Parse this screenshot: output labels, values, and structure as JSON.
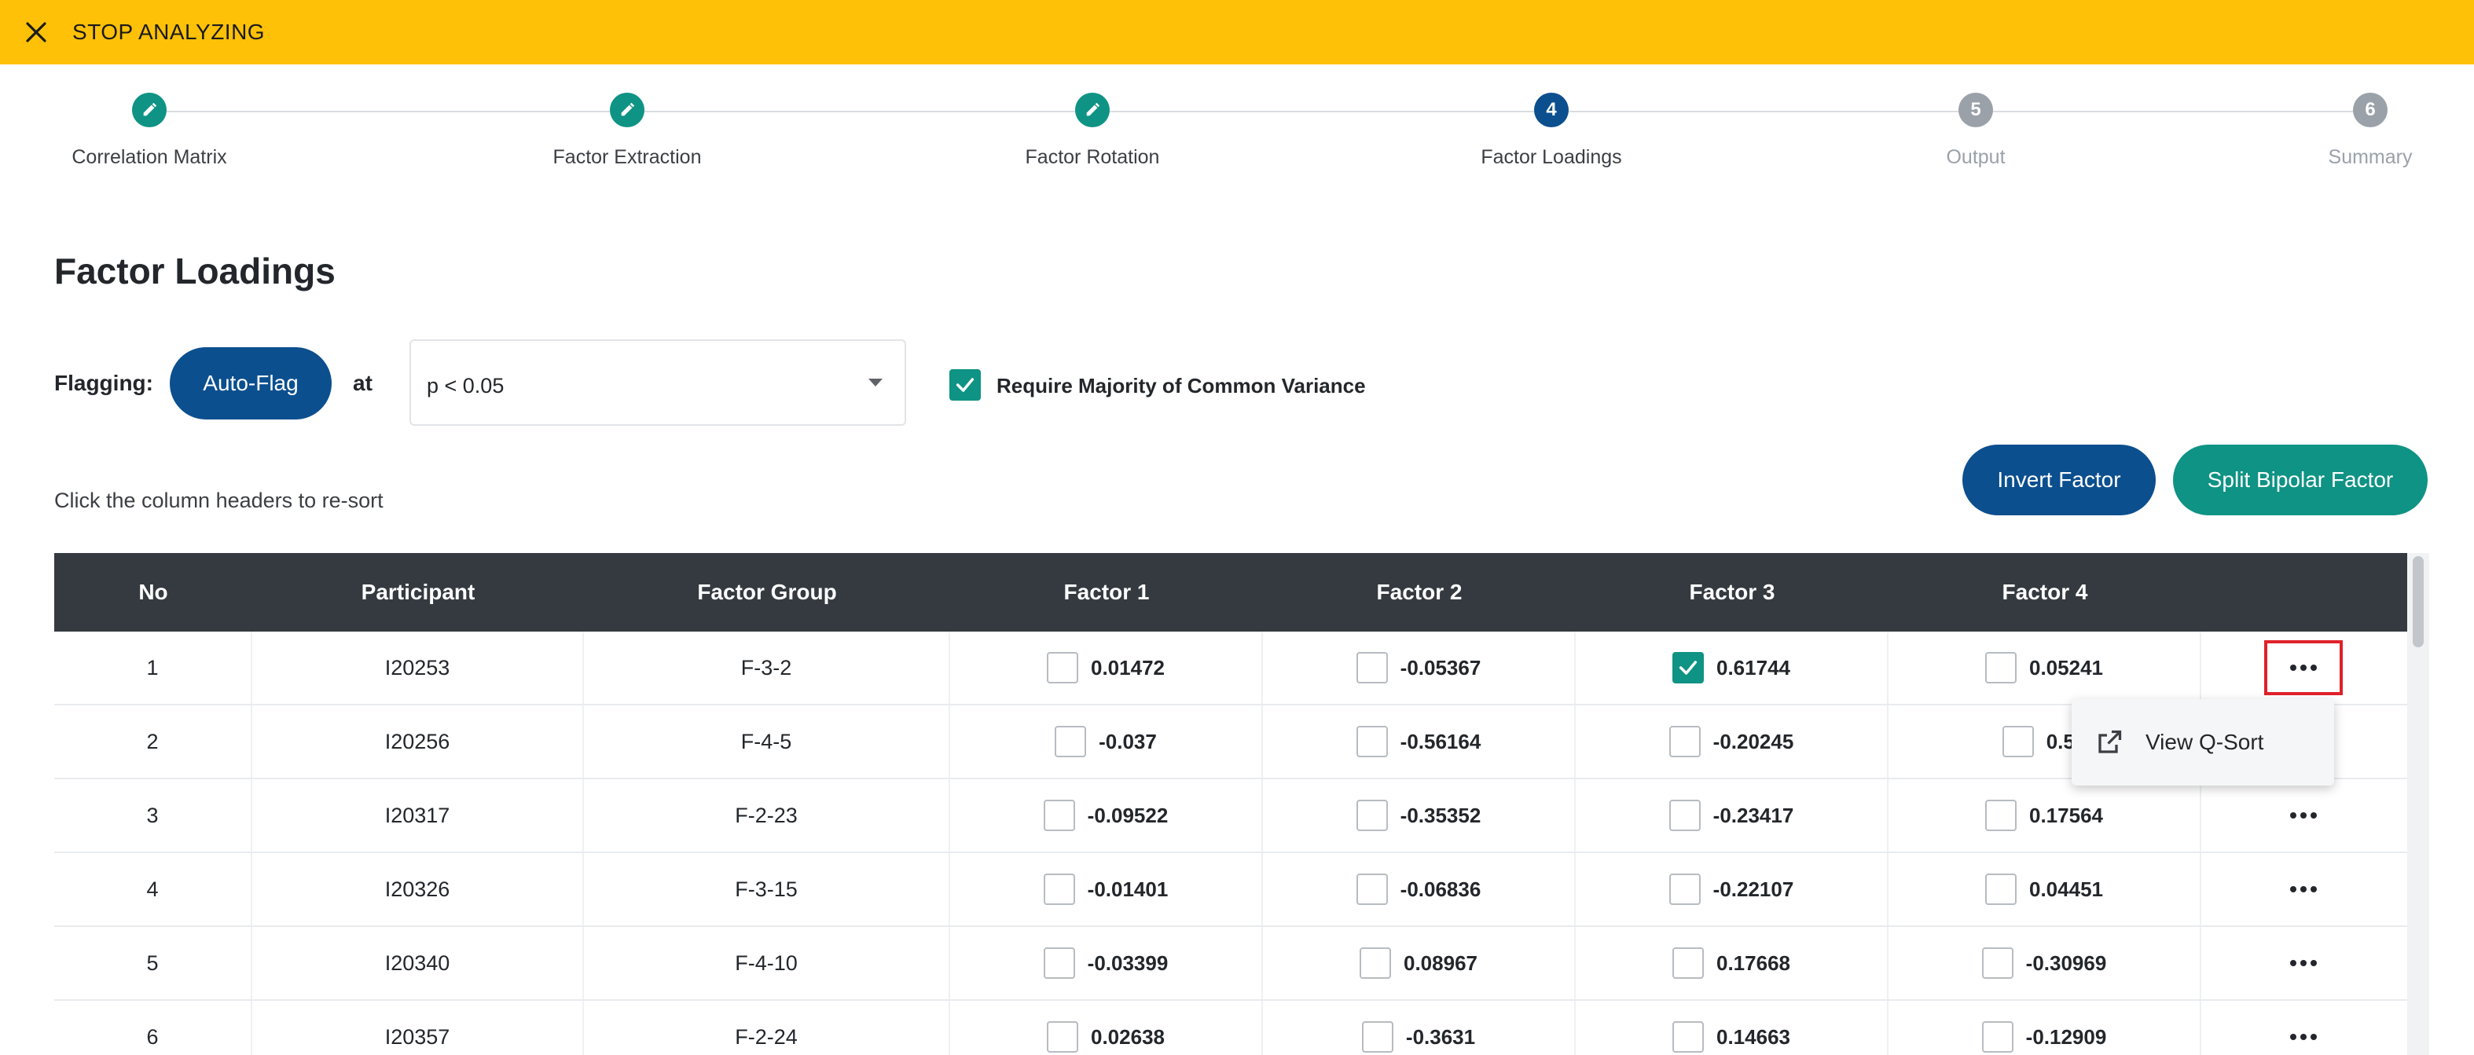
{
  "banner": {
    "label": "STOP ANALYZING",
    "close_icon": "close-icon"
  },
  "stepper": {
    "steps": [
      {
        "number": "",
        "label": "Correlation Matrix",
        "state": "done",
        "icon": "pencil-icon"
      },
      {
        "number": "",
        "label": "Factor Extraction",
        "state": "done",
        "icon": "pencil-icon"
      },
      {
        "number": "",
        "label": "Factor Rotation",
        "state": "done",
        "icon": "pencil-icon"
      },
      {
        "number": "4",
        "label": "Factor Loadings",
        "state": "active"
      },
      {
        "number": "5",
        "label": "Output",
        "state": "todo"
      },
      {
        "number": "6",
        "label": "Summary",
        "state": "todo"
      }
    ]
  },
  "page": {
    "title": "Factor Loadings"
  },
  "flagging": {
    "label": "Flagging:",
    "auto_flag_label": "Auto-Flag",
    "at_label": "at",
    "significance_value": "p < 0.05",
    "majority_checked": true,
    "majority_label": "Require Majority of Common Variance"
  },
  "hint": "Click the column headers to re-sort",
  "actions": {
    "invert_label": "Invert Factor",
    "split_label": "Split Bipolar Factor"
  },
  "table": {
    "headers": [
      "No",
      "Participant",
      "Factor Group",
      "Factor 1",
      "Factor 2",
      "Factor 3",
      "Factor 4"
    ],
    "rows": [
      {
        "no": "1",
        "participant": "I20253",
        "group": "F-3-2",
        "f": [
          "0.01472",
          "-0.05367",
          "0.61744",
          "0.05241"
        ],
        "checked": [
          false,
          false,
          true,
          false
        ]
      },
      {
        "no": "2",
        "participant": "I20256",
        "group": "F-4-5",
        "f": [
          "-0.037",
          "-0.56164",
          "-0.20245",
          "0.59"
        ],
        "checked": [
          false,
          false,
          false,
          false
        ]
      },
      {
        "no": "3",
        "participant": "I20317",
        "group": "F-2-23",
        "f": [
          "-0.09522",
          "-0.35352",
          "-0.23417",
          "0.17564"
        ],
        "checked": [
          false,
          false,
          false,
          false
        ]
      },
      {
        "no": "4",
        "participant": "I20326",
        "group": "F-3-15",
        "f": [
          "-0.01401",
          "-0.06836",
          "-0.22107",
          "0.04451"
        ],
        "checked": [
          false,
          false,
          false,
          false
        ]
      },
      {
        "no": "5",
        "participant": "I20340",
        "group": "F-4-10",
        "f": [
          "-0.03399",
          "0.08967",
          "0.17668",
          "-0.30969"
        ],
        "checked": [
          false,
          false,
          false,
          false
        ]
      },
      {
        "no": "6",
        "participant": "I20357",
        "group": "F-2-24",
        "f": [
          "0.02638",
          "-0.3631",
          "0.14663",
          "-0.12909"
        ],
        "checked": [
          false,
          false,
          false,
          false
        ]
      }
    ]
  },
  "popup": {
    "label": "View Q-Sort",
    "icon": "external-link-icon"
  },
  "colors": {
    "banner": "#ffc107",
    "primary": "#0b4f8f",
    "teal": "#0e9384",
    "header": "#343a40",
    "highlight": "#e0202a"
  }
}
